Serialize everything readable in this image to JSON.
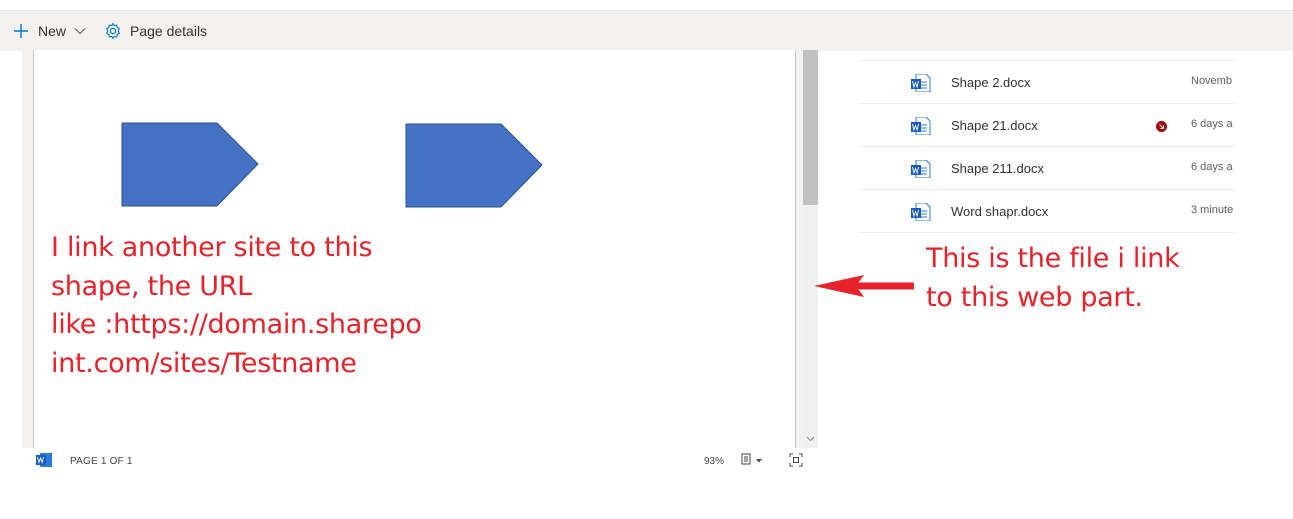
{
  "command_bar": {
    "new_label": "New",
    "page_details_label": "Page details",
    "icons": {
      "new": "plus-icon",
      "dropdown": "chevron-down-icon",
      "details": "gear-icon"
    }
  },
  "document": {
    "text_lines": [
      "I link another site to this",
      "shape, the URL",
      "like :https://domain.sharepo",
      "int.com/sites/Testname"
    ],
    "shape_color": "#4472c4",
    "text_color": "#e8222a"
  },
  "status_bar": {
    "page_count": "PAGE 1 OF 1",
    "zoom": "93%"
  },
  "files": [
    {
      "name": "Shape 2.docx",
      "modified": "Novemb",
      "status_icon": false
    },
    {
      "name": "Shape 21.docx",
      "modified": "6 days a",
      "status_icon": true
    },
    {
      "name": "Shape 211.docx",
      "modified": "6 days a",
      "status_icon": false
    },
    {
      "name": "Word shapr.docx",
      "modified": "3 minute",
      "status_icon": false
    }
  ],
  "annotation": {
    "lines": [
      "This is the file i link",
      "to this web part."
    ],
    "color": "#e8222a"
  }
}
